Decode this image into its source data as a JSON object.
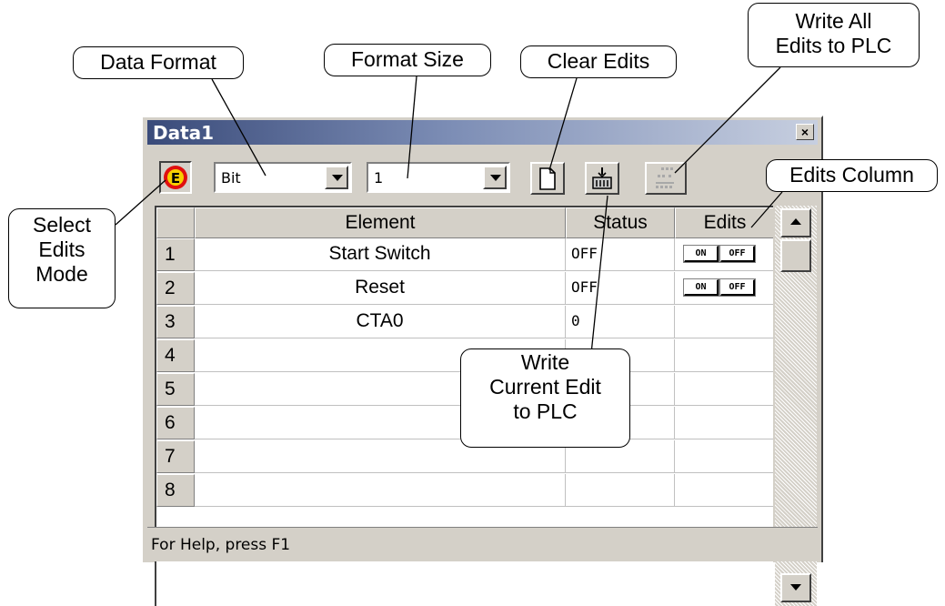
{
  "window": {
    "title": "Data1",
    "close_glyph": "×",
    "status_text": "For Help, press F1"
  },
  "toolbar": {
    "edits_mode_icon": "E",
    "data_format_value": "Bit",
    "format_size_value": "1",
    "clear_edits_icon": "blank-page-icon",
    "write_current_icon": "write-current-edit-icon",
    "write_all_icon": "write-all-edits-icon"
  },
  "table": {
    "columns": [
      "Element",
      "Status",
      "Edits"
    ],
    "rows": [
      {
        "num": "1",
        "element": "Start Switch",
        "status": "OFF",
        "on": "ON",
        "off": "OFF",
        "has_toggle": true
      },
      {
        "num": "2",
        "element": "Reset",
        "status": "OFF",
        "on": "ON",
        "off": "OFF",
        "has_toggle": true
      },
      {
        "num": "3",
        "element": "CTA0",
        "status": "0",
        "has_toggle": false
      },
      {
        "num": "4",
        "element": "",
        "status": "",
        "has_toggle": false
      },
      {
        "num": "5",
        "element": "",
        "status": "",
        "has_toggle": false
      },
      {
        "num": "6",
        "element": "",
        "status": "",
        "has_toggle": false
      },
      {
        "num": "7",
        "element": "",
        "status": "",
        "has_toggle": false
      },
      {
        "num": "8",
        "element": "",
        "status": "",
        "has_toggle": false
      }
    ]
  },
  "callouts": {
    "data_format": "Data Format",
    "format_size": "Format Size",
    "clear_edits": "Clear Edits",
    "write_all": "Write All\nEdits to PLC",
    "edits_column": "Edits Column",
    "select_edits_mode": "Select\nEdits\nMode",
    "write_current": "Write\nCurrent Edit\nto PLC"
  },
  "colors": {
    "title_bar_start": "#3a4b7a",
    "title_bar_end": "#c7cfe0",
    "edits_icon_red": "#e01010",
    "edits_icon_yellow": "#f7d000",
    "window_face": "#d4d0c8"
  }
}
